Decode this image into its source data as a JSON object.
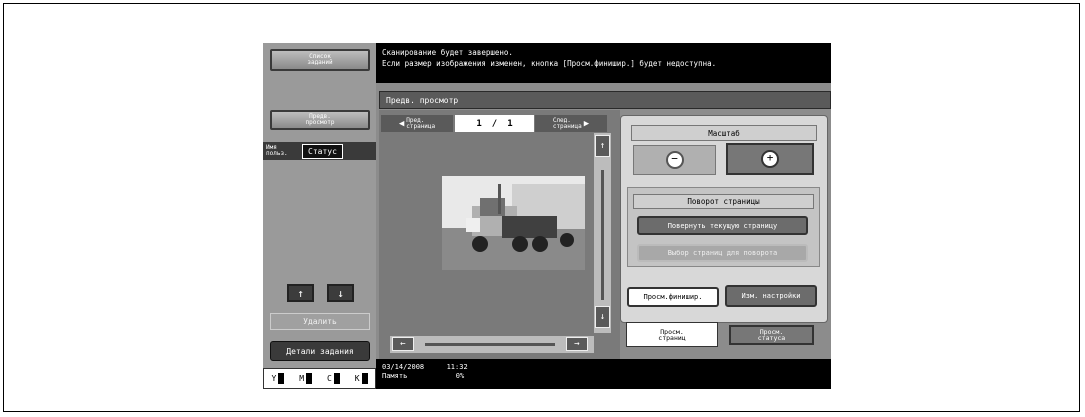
{
  "left_panel": {
    "job_list_label": "Список\nзаданий",
    "preview_label": "Предв.\nпросмотр",
    "user_label": "Имя\nпольз.",
    "status_label": "Статус",
    "up_arrow": "↑",
    "down_arrow": "↓",
    "delete_label": "Удалить",
    "job_details_label": "Детали задания",
    "toner": [
      "Y",
      "M",
      "C",
      "K"
    ]
  },
  "message": {
    "line1": "Сканирование будет завершено.",
    "line2": "Если размер изображения изменен, кнопка [Просм.финишир.] будет недоступна."
  },
  "header": {
    "title": "Предв. просмотр"
  },
  "navigation": {
    "prev_label": "Пред.\nстраница",
    "next_label": "След.\nстраница",
    "page_current": "1",
    "page_total": "1"
  },
  "scale": {
    "title": "Масштаб",
    "zoom_out": "−",
    "zoom_in": "+"
  },
  "rotation": {
    "title": "Поворот страницы",
    "rotate_current": "Повернуть текущую страницу",
    "select_pages": "Выбор страниц для поворота"
  },
  "actions": {
    "finishing_view": "Просм.финишир.",
    "change_settings": "Изм. настройки"
  },
  "tabs": {
    "view_pages": "Просм.\nстраниц",
    "view_status": "Просм.\nстатуса"
  },
  "status_bar": {
    "date": "03/14/2008",
    "time": "11:32",
    "memory_label": "Память",
    "memory_value": "0%"
  },
  "colors": {
    "background": "#8c8c8c",
    "message_bar": "#000000"
  }
}
